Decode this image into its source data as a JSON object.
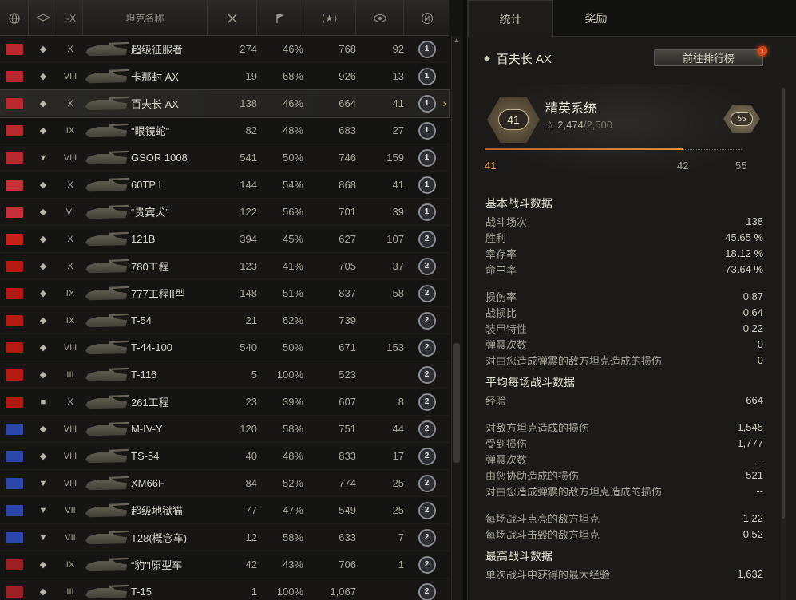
{
  "header": {
    "tier_label": "I-X",
    "name_label": "坦克名称"
  },
  "rows": [
    {
      "nation": "germany",
      "type": "heavy",
      "tier": "X",
      "name": "超级征服者",
      "battles": "274",
      "win": "46%",
      "exp": "768",
      "kills": "92",
      "mark": "1"
    },
    {
      "nation": "germany",
      "type": "heavy",
      "tier": "VIII",
      "name": "卡那封 AX",
      "battles": "19",
      "win": "68%",
      "exp": "926",
      "kills": "13",
      "mark": "1"
    },
    {
      "nation": "germany",
      "type": "medium",
      "tier": "X",
      "name": "百夫长 AX",
      "battles": "138",
      "win": "46%",
      "exp": "664",
      "kills": "41",
      "mark": "1",
      "selected": true
    },
    {
      "nation": "germany",
      "type": "medium",
      "tier": "IX",
      "name": "\"眼镜蛇\"",
      "battles": "82",
      "win": "48%",
      "exp": "683",
      "kills": "27",
      "mark": "1"
    },
    {
      "nation": "germany",
      "type": "td",
      "tier": "VIII",
      "name": "GSOR 1008",
      "battles": "541",
      "win": "50%",
      "exp": "746",
      "kills": "159",
      "mark": "1"
    },
    {
      "nation": "poland",
      "type": "heavy",
      "tier": "X",
      "name": "60TP L",
      "battles": "144",
      "win": "54%",
      "exp": "868",
      "kills": "41",
      "mark": "1"
    },
    {
      "nation": "poland",
      "type": "heavy",
      "tier": "VI",
      "name": "“贵宾犬”",
      "battles": "122",
      "win": "56%",
      "exp": "701",
      "kills": "39",
      "mark": "1"
    },
    {
      "nation": "china",
      "type": "medium",
      "tier": "X",
      "name": "121B",
      "battles": "394",
      "win": "45%",
      "exp": "627",
      "kills": "107",
      "mark": "2"
    },
    {
      "nation": "ussr",
      "type": "heavy",
      "tier": "X",
      "name": "780工程",
      "battles": "123",
      "win": "41%",
      "exp": "705",
      "kills": "37",
      "mark": "2"
    },
    {
      "nation": "ussr",
      "type": "heavy",
      "tier": "IX",
      "name": "777工程II型",
      "battles": "148",
      "win": "51%",
      "exp": "837",
      "kills": "58",
      "mark": "2"
    },
    {
      "nation": "ussr",
      "type": "medium",
      "tier": "IX",
      "name": "T-54",
      "battles": "21",
      "win": "62%",
      "exp": "739",
      "kills": "",
      "mark": "2"
    },
    {
      "nation": "ussr",
      "type": "medium",
      "tier": "VIII",
      "name": "T-44-100",
      "battles": "540",
      "win": "50%",
      "exp": "671",
      "kills": "153",
      "mark": "2"
    },
    {
      "nation": "ussr",
      "type": "light",
      "tier": "III",
      "name": "T-116",
      "battles": "5",
      "win": "100%",
      "exp": "523",
      "kills": "",
      "mark": "2"
    },
    {
      "nation": "ussr",
      "type": "spg",
      "tier": "X",
      "name": "261工程",
      "battles": "23",
      "win": "39%",
      "exp": "607",
      "kills": "8",
      "mark": "2"
    },
    {
      "nation": "usa",
      "type": "heavy",
      "tier": "VIII",
      "name": "M-IV-Y",
      "battles": "120",
      "win": "58%",
      "exp": "751",
      "kills": "44",
      "mark": "2"
    },
    {
      "nation": "usa",
      "type": "heavy",
      "tier": "VIII",
      "name": "TS-54",
      "battles": "40",
      "win": "48%",
      "exp": "833",
      "kills": "17",
      "mark": "2"
    },
    {
      "nation": "usa",
      "type": "td",
      "tier": "VIII",
      "name": "XM66F",
      "battles": "84",
      "win": "52%",
      "exp": "774",
      "kills": "25",
      "mark": "2"
    },
    {
      "nation": "usa",
      "type": "td",
      "tier": "VII",
      "name": "超级地狱猫",
      "battles": "77",
      "win": "47%",
      "exp": "549",
      "kills": "25",
      "mark": "2"
    },
    {
      "nation": "usa",
      "type": "td",
      "tier": "VII",
      "name": "T28(概念车)",
      "battles": "12",
      "win": "58%",
      "exp": "633",
      "kills": "7",
      "mark": "2"
    },
    {
      "nation": "uk",
      "type": "medium",
      "tier": "IX",
      "name": "“豹”I原型车",
      "battles": "42",
      "win": "43%",
      "exp": "706",
      "kills": "1",
      "mark": "2"
    },
    {
      "nation": "uk",
      "type": "medium",
      "tier": "III",
      "name": "T-15",
      "battles": "1",
      "win": "100%",
      "exp": "1,067",
      "kills": "",
      "mark": "2"
    }
  ],
  "colors": {
    "germany": "#b8282c",
    "poland": "#c6303a",
    "china": "#c52116",
    "ussr": "#b51a12",
    "usa": "#2a46a8",
    "uk": "#9c1f24",
    "accent": "#e39a3c"
  },
  "right": {
    "tabs": [
      "统计",
      "奖励"
    ],
    "tank_title": "百夫长 AX",
    "rank_button": "前往排行榜",
    "badge": "1",
    "elite": {
      "level": "41",
      "name": "精英系统",
      "points": "2,474",
      "points_max": "/2,500",
      "next_level": "55",
      "progress": 0.77,
      "label_cur": "41",
      "label_mid": "42",
      "label_max": "55"
    },
    "sections": [
      {
        "title": "基本战斗数据",
        "rows": [
          {
            "k": "战斗场次",
            "v": "138"
          },
          {
            "k": "胜利",
            "v": "45.65 %"
          },
          {
            "k": "幸存率",
            "v": "18.12 %"
          },
          {
            "k": "命中率",
            "v": "73.64 %"
          },
          {
            "gap": true
          },
          {
            "k": "损伤率",
            "v": "0.87"
          },
          {
            "k": "战损比",
            "v": "0.64"
          },
          {
            "k": "装甲特性",
            "v": "0.22"
          },
          {
            "k": "弹震次数",
            "v": "0"
          },
          {
            "k": "对由您造成弹震的敌方坦克造成的损伤",
            "v": "0"
          }
        ]
      },
      {
        "title": "平均每场战斗数据",
        "rows": [
          {
            "k": "经验",
            "v": "664"
          },
          {
            "gap": true
          },
          {
            "k": "对敌方坦克造成的损伤",
            "v": "1,545"
          },
          {
            "k": "受到损伤",
            "v": "1,777"
          },
          {
            "k": "弹震次数",
            "v": "--"
          },
          {
            "k": "由您协助造成的损伤",
            "v": "521"
          },
          {
            "k": "对由您造成弹震的敌方坦克造成的损伤",
            "v": "--"
          },
          {
            "gap": true
          },
          {
            "k": "每场战斗点亮的敌方坦克",
            "v": "1.22"
          },
          {
            "k": "每场战斗击毁的敌方坦克",
            "v": "0.52"
          }
        ]
      },
      {
        "title": "最高战斗数据",
        "rows": [
          {
            "k": "单次战斗中获得的最大经验",
            "v": "1,632"
          }
        ]
      }
    ]
  }
}
